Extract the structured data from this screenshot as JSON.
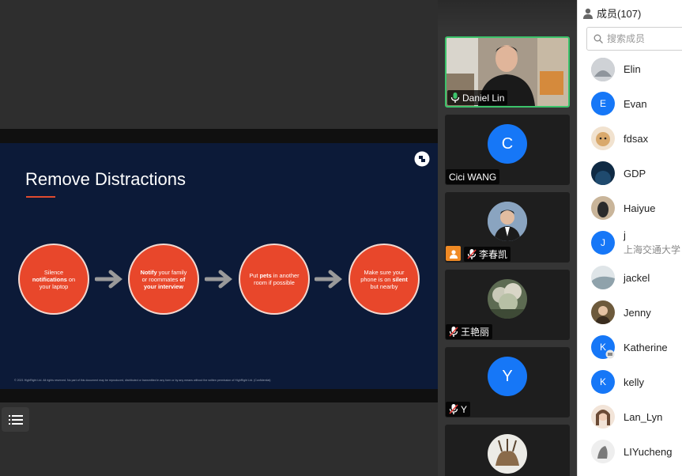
{
  "slide": {
    "title": "Remove Distractions",
    "steps": [
      {
        "pre": "Silence ",
        "bold": "notifications",
        "post": " on your laptop"
      },
      {
        "pre": "",
        "bold": "Notify",
        "post": " your family or roommates ",
        "bold2": "of your interview"
      },
      {
        "pre": "Put ",
        "bold": "pets",
        "post": " in another room if possible"
      },
      {
        "pre": "Make sure your phone is on ",
        "bold": "silent",
        "post": " but nearby"
      }
    ],
    "footer": "© 2021 HighRight Ltd. All rights reserved. No part of this document may be reproduced, distributed or transmitted in any form or by any means without the written permission of HighRight Ltd. (Confidential)"
  },
  "videos": [
    {
      "name": "Daniel Lin",
      "active": true,
      "mic": "on"
    },
    {
      "name": "Cici WANG",
      "letter": "C"
    },
    {
      "name": "李春凯",
      "mic": "muted",
      "badge": "user-icon"
    },
    {
      "name": "王艳丽",
      "mic": "muted"
    },
    {
      "name": "Y",
      "letter": "Y",
      "mic": "muted"
    }
  ],
  "members": {
    "title": "成员(107)",
    "search_placeholder": "搜索成员",
    "list": [
      {
        "name": "Elin",
        "avatar": "photo"
      },
      {
        "name": "Evan",
        "letter": "E"
      },
      {
        "name": "fdsax",
        "avatar": "photo"
      },
      {
        "name": "GDP",
        "avatar": "photo"
      },
      {
        "name": "Haiyue",
        "avatar": "photo"
      },
      {
        "name": "j",
        "letter": "J",
        "sub": "上海交通大学"
      },
      {
        "name": "jackel",
        "avatar": "photo"
      },
      {
        "name": "Jenny",
        "avatar": "photo"
      },
      {
        "name": "Katherine",
        "letter": "K"
      },
      {
        "name": "kelly",
        "letter": "K"
      },
      {
        "name": "Lan_Lyn",
        "avatar": "photo"
      },
      {
        "name": "LIYucheng",
        "avatar": "photo"
      }
    ]
  },
  "colors": {
    "accent_blue": "#1677f7",
    "slide_bg": "#0c1a38",
    "step_circle": "#e8472b",
    "active_border": "#3cc36b"
  }
}
